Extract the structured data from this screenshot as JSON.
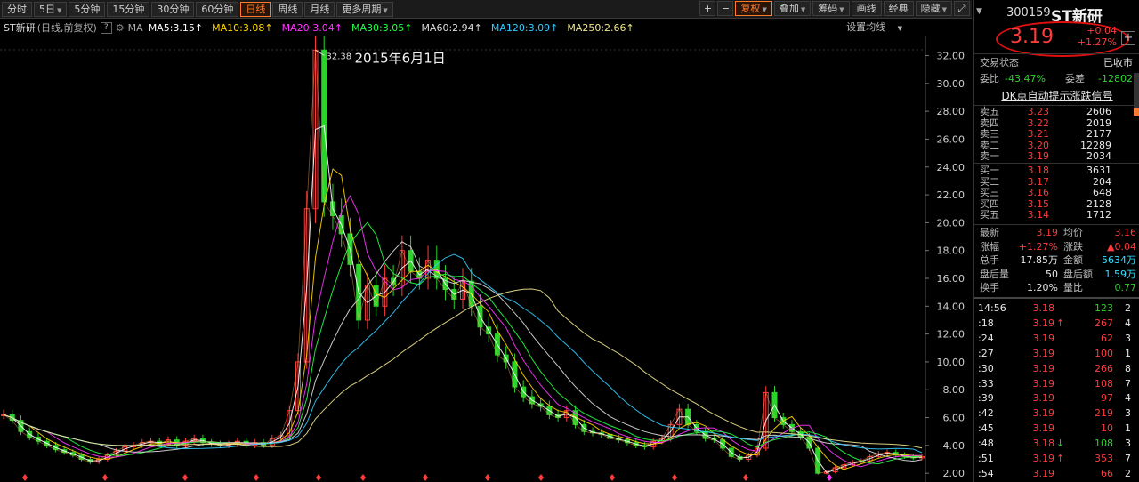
{
  "toolbar": {
    "periods": [
      "分时",
      "5日",
      "5分钟",
      "15分钟",
      "30分钟",
      "60分钟",
      "日线",
      "周线",
      "月线",
      "更多周期"
    ],
    "active_period": "日线",
    "right_buttons": [
      "复权",
      "叠加",
      "筹码",
      "画线",
      "经典",
      "隐藏"
    ]
  },
  "legend": {
    "stock": "ST新研",
    "mode": "(日线,前复权)",
    "help": "?",
    "ma_label": "MA",
    "items": [
      {
        "text": "MA5:3.15",
        "arrow": "↑",
        "color": "#ffffff"
      },
      {
        "text": "MA10:3.08",
        "arrow": "↑",
        "color": "#ffd700"
      },
      {
        "text": "MA20:3.04",
        "arrow": "↑",
        "color": "#ff33ff"
      },
      {
        "text": "MA30:3.05",
        "arrow": "↑",
        "color": "#22ff44"
      },
      {
        "text": "MA60:2.94",
        "arrow": "↑",
        "color": "#dddddd"
      },
      {
        "text": "MA120:3.09",
        "arrow": "↑",
        "color": "#33ccff"
      },
      {
        "text": "MA250:2.66",
        "arrow": "↑",
        "color": "#f0e68c"
      }
    ],
    "settings": "设置均线"
  },
  "chart_data": {
    "type": "line",
    "title": "",
    "annotation": {
      "high_label": "32.38",
      "date_label": "2015年6月1日"
    },
    "y_ticks": [
      "2.00",
      "4.00",
      "6.00",
      "8.00",
      "10.00",
      "12.00",
      "14.00",
      "16.00",
      "18.00",
      "20.00",
      "22.00",
      "24.00",
      "26.00",
      "28.00",
      "30.00",
      "32.00"
    ],
    "ylim": [
      1.5,
      32.8
    ],
    "x": [
      0,
      1,
      2,
      3,
      4,
      5,
      6,
      7,
      8,
      9,
      10,
      11,
      12,
      13,
      14,
      15,
      16,
      17,
      18,
      19,
      20,
      21,
      22,
      23,
      24,
      25,
      26,
      27,
      28,
      29,
      30,
      31,
      32,
      33,
      34,
      35,
      36,
      37,
      38,
      39,
      40,
      41,
      42,
      43,
      44,
      45,
      46,
      47,
      48,
      49,
      50,
      51,
      52,
      53,
      54,
      55,
      56,
      57,
      58,
      59,
      60,
      61,
      62,
      63,
      64,
      65,
      66,
      67,
      68,
      69,
      70,
      71,
      72,
      73,
      74,
      75,
      76,
      77,
      78,
      79,
      80,
      81,
      82,
      83,
      84,
      85,
      86,
      87,
      88,
      89,
      90,
      91,
      92,
      93,
      94,
      95,
      96,
      97,
      98,
      99,
      100,
      101,
      102,
      103,
      104,
      105,
      106
    ],
    "series": [
      {
        "values": [
          6.2,
          5.8,
          5.0,
          4.6,
          4.3,
          4.0,
          3.7,
          3.5,
          3.3,
          3.0,
          2.8,
          3.0,
          3.3,
          3.6,
          3.9,
          4.0,
          4.2,
          4.3,
          4.1,
          4.4,
          4.0,
          4.3,
          4.5,
          4.2,
          4.1,
          4.0,
          4.1,
          4.3,
          4.0,
          4.2,
          4.0,
          4.5,
          4.7,
          6.5,
          10.0,
          21.0,
          32.4,
          21.5,
          20.5,
          19.2,
          17.0,
          13.0,
          15.5,
          14.0,
          16.0,
          15.5,
          18.0,
          16.5,
          16.0,
          17.3,
          16.0,
          15.2,
          14.5,
          15.8,
          14.0,
          12.5,
          12.0,
          10.5,
          10.0,
          8.2,
          7.5,
          7.0,
          6.8,
          6.2,
          6.0,
          6.5,
          5.5,
          5.0,
          4.9,
          4.8,
          4.5,
          4.4,
          4.2,
          4.0,
          3.9,
          4.3,
          4.5,
          5.5,
          6.6,
          5.5,
          5.0,
          4.5,
          4.4,
          3.8,
          3.2,
          3.0,
          3.3,
          3.8,
          7.8,
          6.0,
          5.5,
          5.0,
          4.6,
          3.8,
          2.0,
          2.1,
          2.4,
          2.6,
          2.8,
          2.9,
          3.2,
          3.4,
          3.5,
          3.3,
          3.2,
          3.1,
          3.2
        ]
      }
    ]
  },
  "panel": {
    "code": "300159",
    "name": "ST新研",
    "price": "3.19",
    "change": "+0.04",
    "change_pct": "+1.27%",
    "status_label": "交易状态",
    "status_value": "已收市",
    "webi_label": "委比",
    "webi_value": "-43.47%",
    "weicha_label": "委差",
    "weicha_value": "-12802",
    "dk_banner": "DK点自动提示涨跌信号",
    "asks": [
      {
        "label": "卖五",
        "price": "3.23",
        "vol": "2606"
      },
      {
        "label": "卖四",
        "price": "3.22",
        "vol": "2019"
      },
      {
        "label": "卖三",
        "price": "3.21",
        "vol": "2177"
      },
      {
        "label": "卖二",
        "price": "3.20",
        "vol": "12289"
      },
      {
        "label": "卖一",
        "price": "3.19",
        "vol": "2034"
      }
    ],
    "bids": [
      {
        "label": "买一",
        "price": "3.18",
        "vol": "3631",
        "color": "red"
      },
      {
        "label": "买二",
        "price": "3.17",
        "vol": "204",
        "color": "red"
      },
      {
        "label": "买三",
        "price": "3.16",
        "vol": "648",
        "color": "red"
      },
      {
        "label": "买四",
        "price": "3.15",
        "vol": "2128",
        "color": "white"
      },
      {
        "label": "买五",
        "price": "3.14",
        "vol": "1712",
        "color": "green"
      }
    ],
    "quotes": [
      {
        "l1": "最新",
        "v1": "3.19",
        "c1": "red",
        "l2": "均价",
        "v2": "3.16",
        "c2": "red"
      },
      {
        "l1": "涨幅",
        "v1": "+1.27%",
        "c1": "red",
        "l2": "涨跌",
        "v2": "▲0.04",
        "c2": "red"
      },
      {
        "l1": "总手",
        "v1": "17.85万",
        "c1": "white",
        "l2": "金额",
        "v2": "5634万",
        "c2": "cyan"
      },
      {
        "l1": "盘后量",
        "v1": "50",
        "c1": "white",
        "l2": "盘后额",
        "v2": "1.59万",
        "c2": "cyan"
      },
      {
        "l1": "换手",
        "v1": "1.20%",
        "c1": "white",
        "l2": "量比",
        "v2": "0.77",
        "c2": "green"
      }
    ],
    "ticks": [
      {
        "time": "14:56",
        "price": "3.18",
        "pc": "red",
        "arrow": "",
        "ac": "",
        "vol": "123",
        "vc": "green",
        "n": "2"
      },
      {
        "time": ":18",
        "price": "3.19",
        "pc": "red",
        "arrow": "↑",
        "ac": "red",
        "vol": "267",
        "vc": "red",
        "n": "4"
      },
      {
        "time": ":24",
        "price": "3.19",
        "pc": "red",
        "arrow": "",
        "ac": "",
        "vol": "62",
        "vc": "red",
        "n": "3"
      },
      {
        "time": ":27",
        "price": "3.19",
        "pc": "red",
        "arrow": "",
        "ac": "",
        "vol": "100",
        "vc": "red",
        "n": "1"
      },
      {
        "time": ":30",
        "price": "3.19",
        "pc": "red",
        "arrow": "",
        "ac": "",
        "vol": "266",
        "vc": "red",
        "n": "8"
      },
      {
        "time": ":33",
        "price": "3.19",
        "pc": "red",
        "arrow": "",
        "ac": "",
        "vol": "108",
        "vc": "red",
        "n": "7"
      },
      {
        "time": ":39",
        "price": "3.19",
        "pc": "red",
        "arrow": "",
        "ac": "",
        "vol": "97",
        "vc": "red",
        "n": "4"
      },
      {
        "time": ":42",
        "price": "3.19",
        "pc": "red",
        "arrow": "",
        "ac": "",
        "vol": "219",
        "vc": "red",
        "n": "3"
      },
      {
        "time": ":45",
        "price": "3.19",
        "pc": "red",
        "arrow": "",
        "ac": "",
        "vol": "10",
        "vc": "red",
        "n": "1"
      },
      {
        "time": ":48",
        "price": "3.18",
        "pc": "red",
        "arrow": "↓",
        "ac": "green",
        "vol": "108",
        "vc": "green",
        "n": "3"
      },
      {
        "time": ":51",
        "price": "3.19",
        "pc": "red",
        "arrow": "↑",
        "ac": "red",
        "vol": "353",
        "vc": "red",
        "n": "7"
      },
      {
        "time": ":54",
        "price": "3.19",
        "pc": "red",
        "arrow": "",
        "ac": "",
        "vol": "66",
        "vc": "red",
        "n": "2"
      }
    ]
  },
  "colors": {
    "up": "#ff3b3b",
    "down": "#2bd32b",
    "accent": "#ff7a2a",
    "circle": "#e01010"
  }
}
